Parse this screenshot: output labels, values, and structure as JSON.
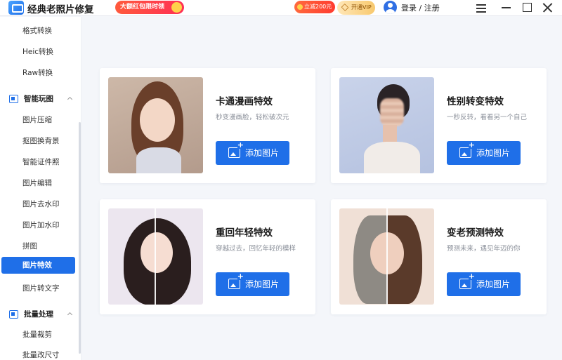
{
  "app": {
    "title": "经典老照片修复",
    "promo_label": "大额红包限时领",
    "coupon_label": "立减200元",
    "vip_label": "开通VIP",
    "login_label": "登录 / 注册"
  },
  "sidebar": {
    "items_top": [
      "格式转换",
      "Heic转换",
      "Raw转换"
    ],
    "group_smart": "智能玩图",
    "items_smart": [
      "图片压缩",
      "抠图换背景",
      "智能证件照",
      "图片编辑",
      "图片去水印",
      "图片加水印",
      "拼图",
      "图片特效",
      "图片转文字"
    ],
    "group_batch": "批量处理",
    "items_batch": [
      "批量裁剪",
      "批量改尺寸"
    ]
  },
  "cards": [
    {
      "title": "卡通漫画特效",
      "desc": "秒变漫画脸，轻松破次元",
      "button": "添加图片"
    },
    {
      "title": "性别转变特效",
      "desc": "一秒反转，看看另一个自己",
      "button": "添加图片"
    },
    {
      "title": "重回年轻特效",
      "desc": "穿越过去，回忆年轻的模样",
      "button": "添加图片"
    },
    {
      "title": "变老预测特效",
      "desc": "预测未来，遇见年迈的你",
      "button": "添加图片"
    }
  ],
  "colors": {
    "accent": "#1f6fe8",
    "sidebar_active": "#1f6fe8",
    "page_bg": "#f4f6fa"
  }
}
